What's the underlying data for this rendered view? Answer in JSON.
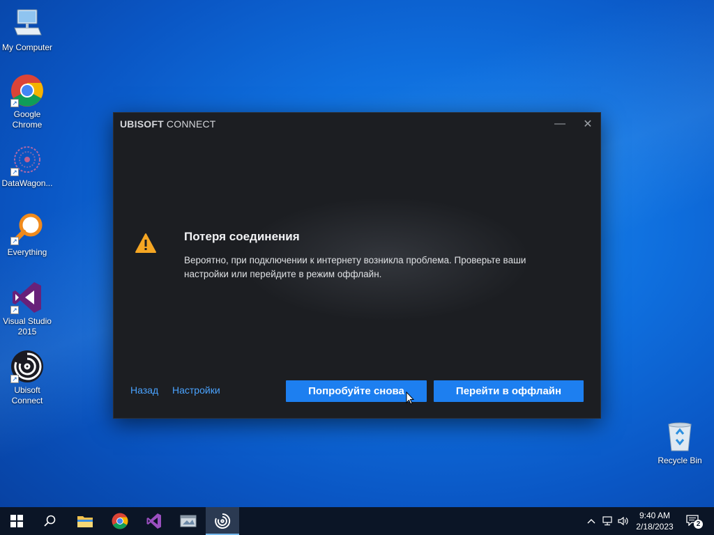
{
  "desktop": {
    "icons": [
      {
        "label": "My Computer"
      },
      {
        "label": "Google Chrome"
      },
      {
        "label": "DataWagon..."
      },
      {
        "label": "Everything"
      },
      {
        "label": "Visual Studio 2015"
      },
      {
        "label": "Ubisoft Connect"
      },
      {
        "label": "Recycle Bin"
      }
    ]
  },
  "dialog": {
    "brand_bold": "UBISOFT",
    "brand_rest": " CONNECT",
    "minimize_glyph": "—",
    "close_glyph": "✕",
    "title": "Потеря соединения",
    "message": "Вероятно, при подключении к интернету возникла проблема. Проверьте ваши настройки или перейдите в режим оффлайн.",
    "back_link": "Назад",
    "settings_link": "Настройки",
    "retry_button": "Попробуйте снова",
    "offline_button": "Перейти в оффлайн",
    "accent_color": "#1d7ff0",
    "warning_color": "#f5a623"
  },
  "taskbar": {
    "time": "9:40 AM",
    "date": "2/18/2023",
    "notification_count": "2",
    "pinned": [
      "start-button",
      "search-button",
      "file-explorer",
      "google-chrome",
      "visual-studio",
      "app-window",
      "ubisoft-connect"
    ],
    "active_app": "ubisoft-connect"
  }
}
